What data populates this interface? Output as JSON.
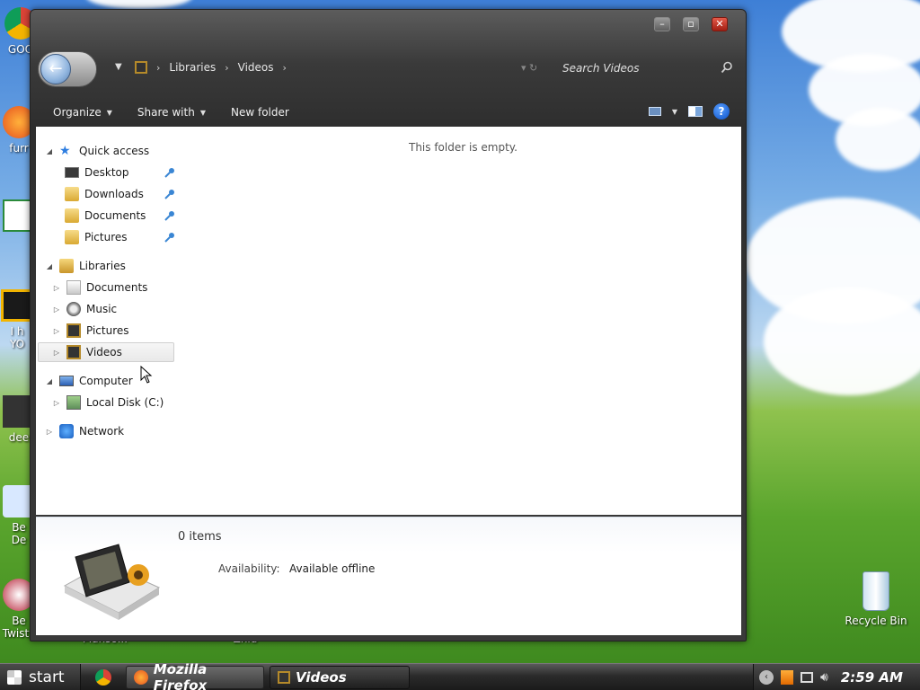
{
  "desktop": {
    "icons": [
      {
        "label": "GOO"
      },
      {
        "label": "furr"
      },
      {
        "label": "I h"
      },
      {
        "label": "YO"
      },
      {
        "label": "dee"
      },
      {
        "label": "Be"
      },
      {
        "label": "De"
      },
      {
        "label": "Be"
      },
      {
        "label": "Twisty"
      },
      {
        "label": "Manso..."
      },
      {
        "label": "Zhid"
      }
    ],
    "recycle_bin": "Recycle Bin"
  },
  "window": {
    "breadcrumb": [
      "Libraries",
      "Videos"
    ],
    "search_placeholder": "Search Videos",
    "toolbar": {
      "organize": "Organize",
      "share_with": "Share with",
      "new_folder": "New folder"
    },
    "empty_message": "This folder is empty.",
    "nav": {
      "quick_access": "Quick access",
      "quick_items": [
        "Desktop",
        "Downloads",
        "Documents",
        "Pictures"
      ],
      "libraries": "Libraries",
      "library_items": [
        "Documents",
        "Music",
        "Pictures",
        "Videos"
      ],
      "computer": "Computer",
      "local_disk": "Local Disk (C:)",
      "network": "Network"
    },
    "details": {
      "item_count": "0 items",
      "availability_label": "Availability:",
      "availability_value": "Available offline"
    }
  },
  "taskbar": {
    "start": "start",
    "tasks": [
      "Mozilla Firefox",
      "Videos"
    ],
    "clock": "2:59 AM"
  },
  "colors": {
    "accent_blue": "#0a4fc7",
    "window_chrome": "#3a3a3a",
    "close_red": "#c4311f"
  }
}
